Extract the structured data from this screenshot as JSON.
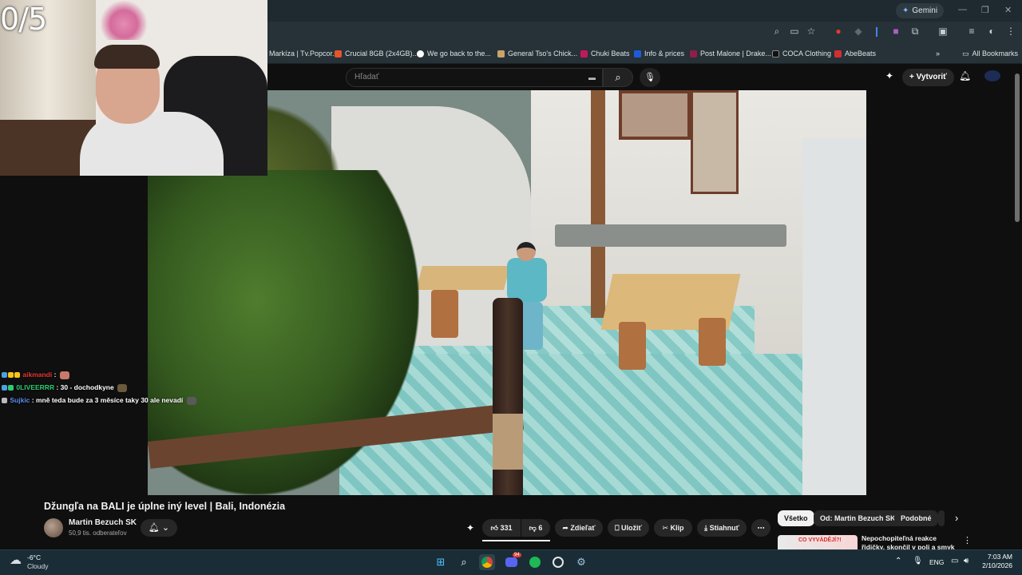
{
  "browser": {
    "gemini_label": "Gemini",
    "bookmarks": [
      "Markíza | Tv.Popcor...",
      "Crucial 8GB (2x4GB)...",
      "We go back to the...",
      "General Tso's Chick...",
      "Chuki Beats",
      "Info & prices",
      "Post Malone | Drake...",
      "COCA Clothing",
      "AbeBeats"
    ],
    "all_bookmarks_label": "All Bookmarks",
    "colors": {
      "tabstrip": "#1f2a30",
      "toolbar": "#263238"
    }
  },
  "youtube": {
    "search_placeholder": "Hľadať",
    "create_label": "Vytvoriť",
    "video": {
      "title": "Džungľa na BALI je úplne iný level | Bali, Indonézia",
      "channel_name": "Martin Bezuch SK",
      "subscribers": "50,9 tis. odberateľov",
      "likes": "331",
      "dislikes": "6",
      "share_label": "Zdieľať",
      "save_label": "Uložiť",
      "clip_label": "Klip",
      "download_label": "Stiahnuť",
      "more_label": "⋯"
    },
    "chips": [
      "Všetko",
      "Od: Martin Bezuch SK",
      "Podobné"
    ],
    "recommended": {
      "thumb_text": "CO VYVÁDĚJÍ?!",
      "title": "Nepochopiteľná reakce řidičky, skončil v poli a smyk na ledový"
    }
  },
  "overlay": {
    "score": "0/5",
    "chat": [
      {
        "user": "aikmandi",
        "user_color": "#e53935",
        "message": "",
        "has_emote": true,
        "emote_color": "#c8796a"
      },
      {
        "user": "0LIVEERRR",
        "user_color": "#2ecc71",
        "message": ": 30 - dochodkyne",
        "has_emote": true,
        "emote_color": "#6b5a3a"
      },
      {
        "user": "Sujkic",
        "user_color": "#5b8def",
        "message": ": mně teda bude za 3 měsíce taky 30 ale nevadí",
        "has_emote": true,
        "emote_color": "#5a5a5a"
      }
    ]
  },
  "taskbar": {
    "weather_temp": "-6°C",
    "weather_cond": "Cloudy",
    "language": "ENG",
    "time": "7:03 AM",
    "date": "2/10/2026",
    "apps": [
      "start-icon",
      "search-icon",
      "chrome-icon",
      "discord-icon",
      "spotify-icon",
      "obs-icon",
      "steam-icon"
    ],
    "badges": {
      "discord": "94"
    }
  }
}
